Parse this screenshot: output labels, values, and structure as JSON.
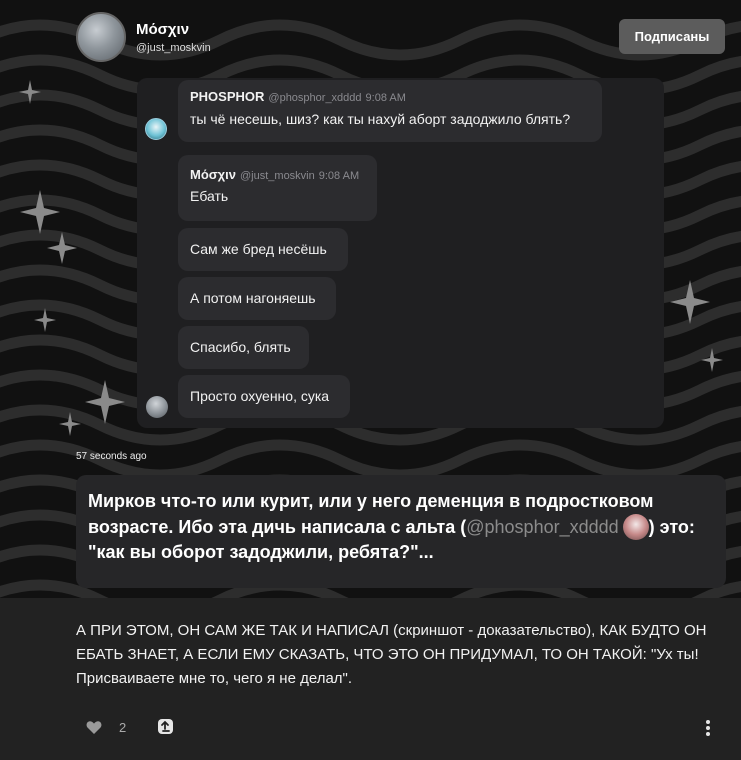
{
  "author": {
    "name": "Μόσχιν",
    "handle": "@just_moskvin"
  },
  "subscribe_button": "Подписаны",
  "chat": {
    "first": {
      "name": "PHOSPHOR",
      "handle": "@phosphor_xdddd",
      "time": "9:08 AM",
      "text": "ты чё несешь, шиз? как ты нахуй аборт задоджило блять?"
    },
    "second": {
      "name": "Μόσχιν",
      "handle": "@just_moskvin",
      "time": "9:08 AM",
      "messages": [
        "Ебать",
        "Сам же бред несёшь",
        "А потом нагоняешь",
        "Спасибо, блять",
        "Просто охуенно, сука"
      ]
    }
  },
  "timestamp": "57 seconds ago",
  "caption": {
    "part1": "Мирков что-то или курит, или у него деменция в подростковом возрасте. Ибо эта дичь написала с альта (",
    "mention": "@phosphor_xdddd",
    "part2": ") это: \"как вы оборот задоджили, ребята?\"..."
  },
  "post_text": "А ПРИ ЭТОМ, ОН САМ ЖЕ ТАК И НАПИСАЛ (скриншот - доказательство), КАК БУДТО ОН ЕБАТЬ ЗНАЕТ, А ЕСЛИ ЕМУ СКАЗАТЬ, ЧТО ЭТО ОН ПРИДУМАЛ, ТО ОН ТАКОЙ: \"Ух ты! Присваиваете мне то, чего я не делал\".",
  "footer": {
    "like_count": "2"
  },
  "icons": {
    "like": "heart-icon",
    "repost": "repost-icon",
    "more": "more-vertical-icon"
  },
  "colors": {
    "hero_background": "#111111",
    "card_background": "#1f1f21",
    "bubble_background": "#2c2c2f",
    "button_background": "#5c5c5c",
    "page_background": "#222222"
  }
}
